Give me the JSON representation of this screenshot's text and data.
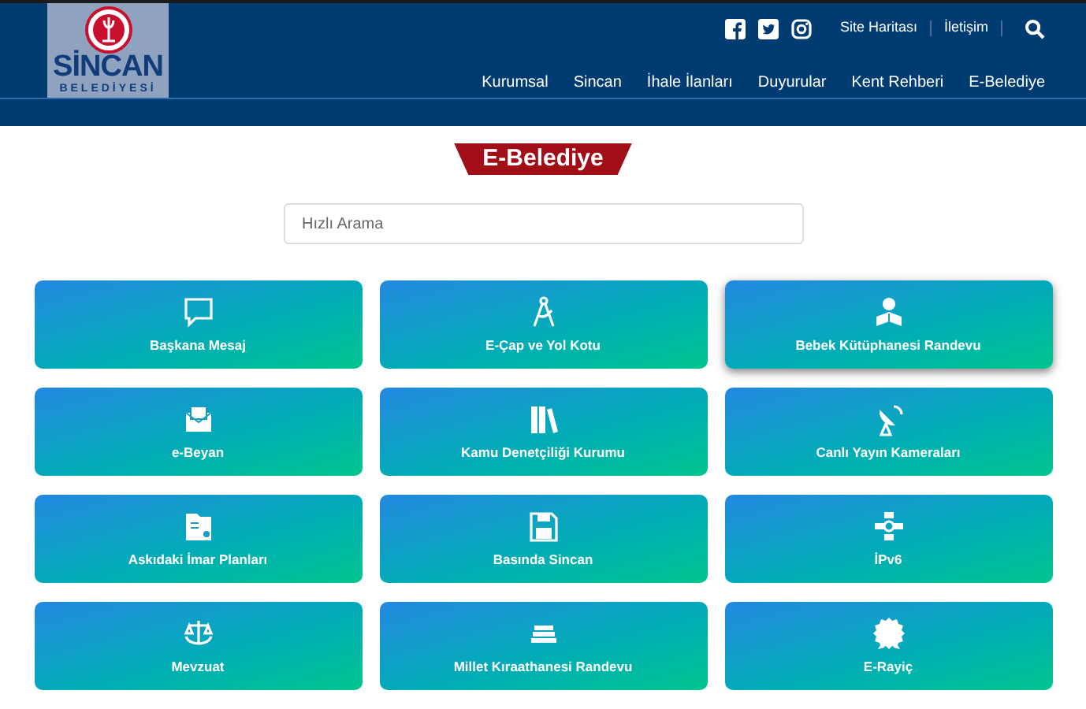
{
  "logo": {
    "name": "SİNCAN",
    "subtitle": "BELEDİYESİ"
  },
  "top_links": [
    "Site Haritası",
    "İletişim"
  ],
  "nav": [
    "Kurumsal",
    "Sincan",
    "İhale İlanları",
    "Duyurular",
    "Kent Rehberi",
    "E-Belediye"
  ],
  "page_title": "E-Belediye",
  "search": {
    "placeholder": "Hızlı Arama"
  },
  "tiles": [
    {
      "label": "Başkana Mesaj",
      "hovered": false
    },
    {
      "label": "E-Çap ve Yol Kotu",
      "hovered": false
    },
    {
      "label": "Bebek Kütüphanesi Randevu",
      "hovered": true
    },
    {
      "label": "e-Beyan",
      "hovered": false
    },
    {
      "label": "Kamu Denetçiliği Kurumu",
      "hovered": false
    },
    {
      "label": "Canlı Yayın Kameraları",
      "hovered": false
    },
    {
      "label": "Askıdaki İmar Planları",
      "hovered": false
    },
    {
      "label": "Basında Sincan",
      "hovered": false
    },
    {
      "label": "İPv6",
      "hovered": false
    },
    {
      "label": "Mevzuat",
      "hovered": false
    },
    {
      "label": "Millet Kıraathanesi Randevu",
      "hovered": false
    },
    {
      "label": "E-Rayiç",
      "hovered": false
    }
  ]
}
